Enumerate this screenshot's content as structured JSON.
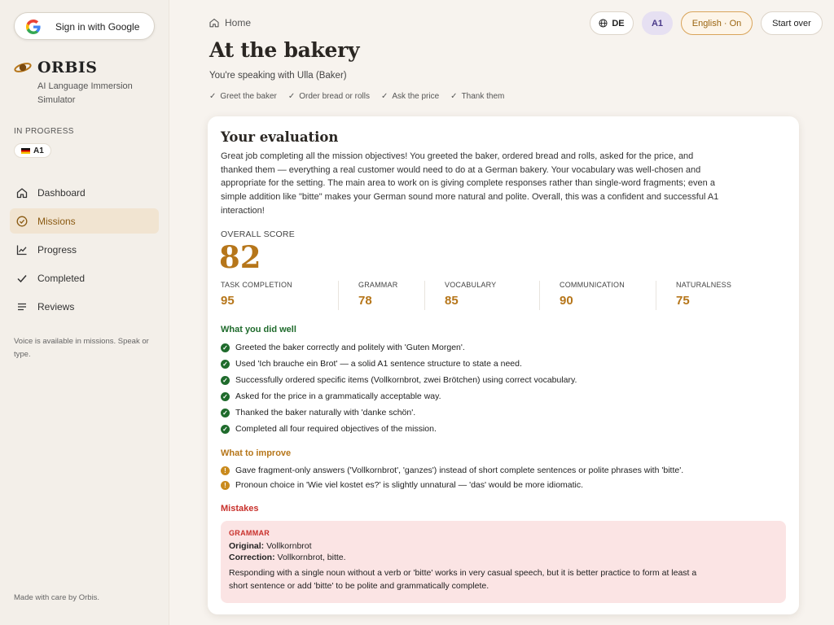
{
  "sidebar": {
    "google_label": "Sign in with Google",
    "brand_name": "ORBIS",
    "tagline": "AI Language Immersion Simulator",
    "in_progress_label": "IN PROGRESS",
    "level_chip": "A1",
    "nav": [
      {
        "label": "Dashboard",
        "icon": "home-icon"
      },
      {
        "label": "Missions",
        "icon": "target-icon",
        "active": true
      },
      {
        "label": "Progress",
        "icon": "chart-icon"
      },
      {
        "label": "Completed",
        "icon": "check-icon"
      },
      {
        "label": "Reviews",
        "icon": "list-icon"
      }
    ],
    "voice_note": "Voice is available in missions. Speak or type.",
    "footer": "Made with care by Orbis."
  },
  "header": {
    "breadcrumb": "Home",
    "lang_code": "DE",
    "level": "A1",
    "english_toggle": "English · On",
    "start_over": "Start over"
  },
  "mission": {
    "title": "At the bakery",
    "subtitle": "You're speaking with Ulla (Baker)",
    "objectives": [
      "Greet the baker",
      "Order bread or rolls",
      "Ask the price",
      "Thank them"
    ]
  },
  "evaluation": {
    "title": "Your evaluation",
    "summary": "Great job completing all the mission objectives! You greeted the baker, ordered bread and rolls, asked for the price, and thanked them — everything a real customer would need to do at a German bakery. Your vocabulary was well-chosen and appropriate for the setting. The main area to work on is giving complete responses rather than single-word fragments; even a simple addition like \"bitte\" makes your German sound more natural and polite. Overall, this was a confident and successful A1 interaction!",
    "overall_label": "OVERALL SCORE",
    "overall_score": "82",
    "metrics": [
      {
        "label": "TASK COMPLETION",
        "value": "95"
      },
      {
        "label": "GRAMMAR",
        "value": "78"
      },
      {
        "label": "VOCABULARY",
        "value": "85"
      },
      {
        "label": "COMMUNICATION",
        "value": "90"
      },
      {
        "label": "NATURALNESS",
        "value": "75"
      }
    ],
    "did_well_title": "What you did well",
    "did_well": [
      "Greeted the baker correctly and politely with 'Guten Morgen'.",
      "Used 'Ich brauche ein Brot' — a solid A1 sentence structure to state a need.",
      "Successfully ordered specific items (Vollkornbrot, zwei Brötchen) using correct vocabulary.",
      "Asked for the price in a grammatically acceptable way.",
      "Thanked the baker naturally with 'danke schön'.",
      "Completed all four required objectives of the mission."
    ],
    "improve_title": "What to improve",
    "improve": [
      "Gave fragment-only answers ('Vollkornbrot', 'ganzes') instead of short complete sentences or polite phrases with 'bitte'.",
      "Pronoun choice in 'Wie viel kostet es?' is slightly unnatural — 'das' would be more idiomatic."
    ],
    "mistakes_title": "Mistakes",
    "mistake": {
      "category": "GRAMMAR",
      "original_label": "Original:",
      "original": "Vollkornbrot",
      "correction_label": "Correction:",
      "correction": "Vollkornbrot, bitte.",
      "explanation": "Responding with a single noun without a verb or 'bitte' works in very casual speech, but it is better practice to form at least a short sentence or add 'bitte' to be polite and grammatically complete."
    }
  },
  "colors": {
    "accent": "#b6761a",
    "good": "#1f6b2c",
    "error": "#c8302b",
    "active_nav_bg": "#f1e4d1"
  }
}
